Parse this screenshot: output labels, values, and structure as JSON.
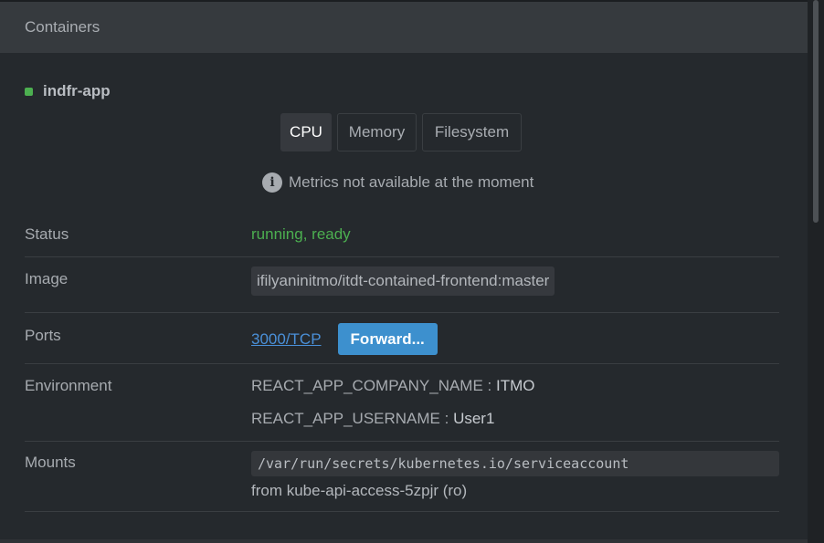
{
  "section": {
    "title": "Containers"
  },
  "container": {
    "name": "indfr-app",
    "status_color": "#4caf50"
  },
  "tabs": [
    {
      "label": "CPU",
      "active": true
    },
    {
      "label": "Memory",
      "active": false
    },
    {
      "label": "Filesystem",
      "active": false
    }
  ],
  "notice": {
    "icon": "info-icon",
    "text": "Metrics not available at the moment"
  },
  "details": {
    "status": {
      "label": "Status",
      "value": "running, ready"
    },
    "image": {
      "label": "Image",
      "value": "ifilyaninitmo/itdt-contained-frontend:master"
    },
    "ports": {
      "label": "Ports",
      "port": "3000/TCP",
      "forward_label": "Forward..."
    },
    "environment": {
      "label": "Environment",
      "vars": [
        {
          "key": "REACT_APP_COMPANY_NAME",
          "sep": " : ",
          "value": "ITMO"
        },
        {
          "key": "REACT_APP_USERNAME",
          "sep": " : ",
          "value": "User1"
        }
      ]
    },
    "mounts": {
      "label": "Mounts",
      "path": "/var/run/secrets/kubernetes.io/serviceaccount",
      "from": "from kube-api-access-5zpjr (ro)"
    }
  },
  "colors": {
    "accent": "#3d90ce",
    "status_ok": "#4caf50",
    "link": "#4a90d9"
  }
}
